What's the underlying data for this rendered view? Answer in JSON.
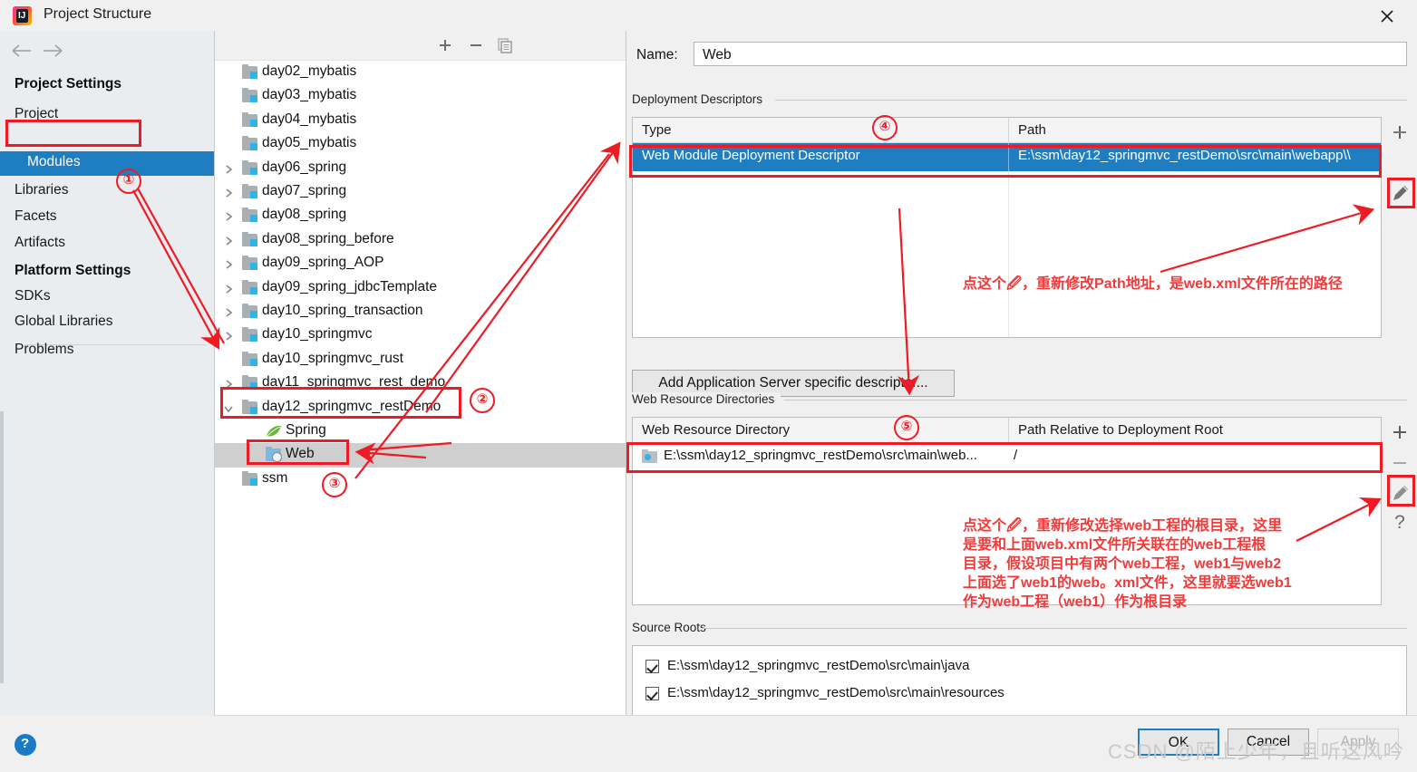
{
  "window": {
    "title": "Project Structure",
    "app_icon": "intellij-idea-icon",
    "close_icon": "close-icon"
  },
  "sidebar": {
    "groups": [
      {
        "heading": "Project Settings",
        "items": [
          "Project",
          "Modules",
          "Libraries",
          "Facets",
          "Artifacts"
        ]
      },
      {
        "heading": "Platform Settings",
        "items": [
          "SDKs",
          "Global Libraries"
        ]
      }
    ],
    "selected_item": "Modules",
    "extra_items": [
      "Problems"
    ],
    "help_icon": "help-icon"
  },
  "modules_toolbar": {
    "add_icon": "plus-icon",
    "remove_icon": "minus-icon",
    "copy_icon": "copy-icon"
  },
  "module_tree": {
    "items": [
      {
        "label": "day02_mybatis",
        "icon": "module-folder-icon",
        "chevron": "",
        "indent": 0
      },
      {
        "label": "day03_mybatis",
        "icon": "module-folder-icon",
        "chevron": "",
        "indent": 0
      },
      {
        "label": "day04_mybatis",
        "icon": "module-folder-icon",
        "chevron": "",
        "indent": 0
      },
      {
        "label": "day05_mybatis",
        "icon": "module-folder-icon",
        "chevron": "",
        "indent": 0
      },
      {
        "label": "day06_spring",
        "icon": "module-folder-icon",
        "chevron": "collapsed",
        "indent": 0
      },
      {
        "label": "day07_spring",
        "icon": "module-folder-icon",
        "chevron": "collapsed",
        "indent": 0
      },
      {
        "label": "day08_spring",
        "icon": "module-folder-icon",
        "chevron": "collapsed",
        "indent": 0
      },
      {
        "label": "day08_spring_before",
        "icon": "module-folder-icon",
        "chevron": "collapsed",
        "indent": 0
      },
      {
        "label": "day09_spring_AOP",
        "icon": "module-folder-icon",
        "chevron": "collapsed",
        "indent": 0
      },
      {
        "label": "day09_spring_jdbcTemplate",
        "icon": "module-folder-icon",
        "chevron": "collapsed",
        "indent": 0
      },
      {
        "label": "day10_spring_transaction",
        "icon": "module-folder-icon",
        "chevron": "collapsed",
        "indent": 0
      },
      {
        "label": "day10_springmvc",
        "icon": "module-folder-icon",
        "chevron": "collapsed",
        "indent": 0
      },
      {
        "label": "day10_springmvc_rust",
        "icon": "module-folder-icon",
        "chevron": "",
        "indent": 0
      },
      {
        "label": "day11_springmvc_rest_demo",
        "icon": "module-folder-icon",
        "chevron": "collapsed",
        "indent": 0
      },
      {
        "label": "day12_springmvc_restDemo",
        "icon": "module-folder-icon",
        "chevron": "expanded",
        "indent": 0
      },
      {
        "label": "Spring",
        "icon": "spring-leaf-icon",
        "chevron": "",
        "indent": 1
      },
      {
        "label": "Web",
        "icon": "web-facet-icon",
        "chevron": "",
        "indent": 1
      },
      {
        "label": "ssm",
        "icon": "module-folder-icon",
        "chevron": "",
        "indent": 0
      }
    ],
    "selected": "Web"
  },
  "detail": {
    "name_label": "Name:",
    "name_value": "Web",
    "deployment_descriptors": {
      "group_title": "Deployment Descriptors",
      "columns": [
        "Type",
        "Path"
      ],
      "rows": [
        {
          "type": "Web Module Deployment Descriptor",
          "path": "E:\\ssm\\day12_springmvc_restDemo\\src\\main\\webapp\\\\",
          "selected": true
        }
      ],
      "buttons": [
        "plus-icon",
        "minus-icon",
        "pencil-icon"
      ],
      "add_descriptor_button": "Add Application Server specific descriptor..."
    },
    "web_resource_directories": {
      "group_title": "Web Resource Directories",
      "columns": [
        "Web Resource Directory",
        "Path Relative to Deployment Root"
      ],
      "rows": [
        {
          "directory": "E:\\ssm\\day12_springmvc_restDemo\\src\\main\\web...",
          "relative": "/",
          "icon": "folder-web-icon"
        }
      ],
      "buttons": [
        "plus-icon",
        "minus-icon",
        "pencil-icon",
        "help-icon"
      ]
    },
    "source_roots": {
      "group_title": "Source Roots",
      "rows": [
        {
          "path": "E:\\ssm\\day12_springmvc_restDemo\\src\\main\\java",
          "checked": true
        },
        {
          "path": "E:\\ssm\\day12_springmvc_restDemo\\src\\main\\resources",
          "checked": true
        }
      ]
    }
  },
  "footer": {
    "ok": "OK",
    "cancel": "Cancel",
    "apply": "Apply",
    "watermark": "CSDN @陌上少年，且听这风吟"
  },
  "annotations": {
    "numbers": [
      "①",
      "②",
      "③",
      "④",
      "⑤"
    ],
    "note_path": "点这个🖉，重新修改Path地址，是web.xml文件所在的路径",
    "note_webroot_lines": [
      "点这个🖉，重新修改选择web工程的根目录，这里",
      "是要和上面web.xml文件所关联在的web工程根",
      "目录，假设项目中有两个web工程，web1与web2",
      "上面选了web1的web。xml文件，这里就要选web1",
      "作为web工程（web1）作为根目录"
    ],
    "accent_red": "#ee1b24",
    "text_red": "#f23a3a"
  }
}
